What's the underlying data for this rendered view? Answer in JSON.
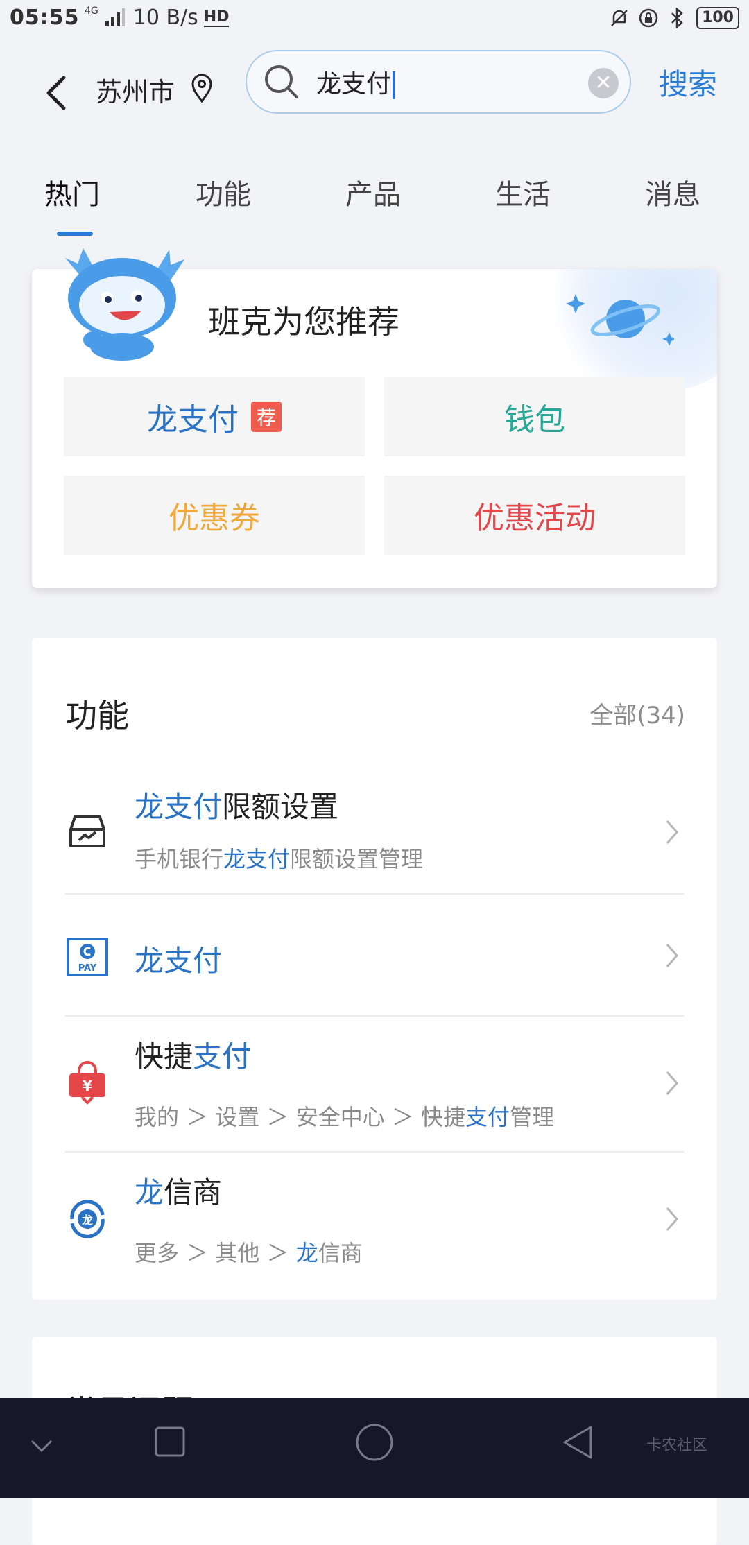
{
  "status_bar": {
    "time": "05:55",
    "network": "4G",
    "speed": "10 B/s",
    "hd": "HD",
    "battery": "100"
  },
  "header": {
    "city": "苏州市",
    "search_value": "龙支付",
    "search_button": "搜索"
  },
  "tabs": [
    {
      "label": "热门",
      "active": true
    },
    {
      "label": "功能",
      "active": false
    },
    {
      "label": "产品",
      "active": false
    },
    {
      "label": "生活",
      "active": false
    },
    {
      "label": "消息",
      "active": false
    }
  ],
  "recommend": {
    "title": "班克为您推荐",
    "chips": [
      {
        "label": "龙支付",
        "tag": "荐",
        "color": "#2a72c6"
      },
      {
        "label": "钱包",
        "color": "#27a897"
      },
      {
        "label": "优惠券",
        "color": "#f0a93a"
      },
      {
        "label": "优惠活动",
        "color": "#e3474a"
      }
    ]
  },
  "functions": {
    "title": "功能",
    "all_label": "全部(34)",
    "items": [
      {
        "title_hl": "龙支付",
        "title_rest": "限额设置",
        "sub_pre": "手机银行",
        "sub_hl": "龙支付",
        "sub_post": "限额设置管理",
        "icon": "limit-setting-icon"
      },
      {
        "title_hl": "龙支付",
        "title_rest": "",
        "icon": "pay-icon"
      },
      {
        "title_pre": "快捷",
        "title_hl": "支付",
        "sub_path": "我的 ＞ 设置 ＞ 安全中心 ＞ 快捷",
        "sub_hl": "支付",
        "sub_post": "管理",
        "icon": "quick-pay-icon"
      },
      {
        "title_hl": "龙",
        "title_rest": "信商",
        "sub_path": "更多 ＞ 其他 ＞ ",
        "sub_hl": "龙",
        "sub_post": "信商",
        "icon": "long-merchant-icon"
      }
    ]
  },
  "next_section": {
    "title_partial": "常见问题"
  },
  "watermark": "卡农社区",
  "colors": {
    "accent": "#2a7bd3",
    "highlight": "#2a72c6",
    "navbar": "#161829"
  }
}
